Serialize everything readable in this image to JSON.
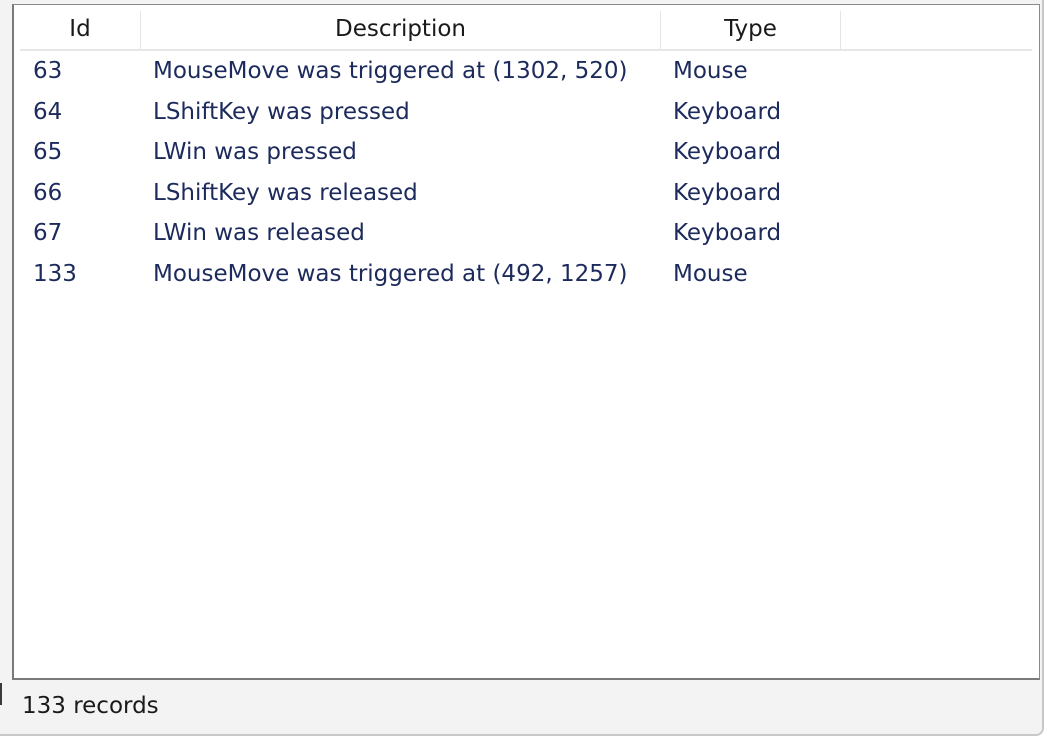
{
  "table": {
    "columns": [
      "Id",
      "Description",
      "Type"
    ],
    "rows": [
      {
        "id": "63",
        "description": "MouseMove was triggered at (1302, 520)",
        "type": "Mouse"
      },
      {
        "id": "64",
        "description": "LShiftKey was pressed",
        "type": "Keyboard"
      },
      {
        "id": "65",
        "description": "LWin was pressed",
        "type": "Keyboard"
      },
      {
        "id": "66",
        "description": "LShiftKey was released",
        "type": "Keyboard"
      },
      {
        "id": "67",
        "description": "LWin was released",
        "type": "Keyboard"
      },
      {
        "id": "133",
        "description": "MouseMove was triggered at (492, 1257)",
        "type": "Mouse"
      }
    ]
  },
  "status": {
    "records_text": "133 records"
  }
}
